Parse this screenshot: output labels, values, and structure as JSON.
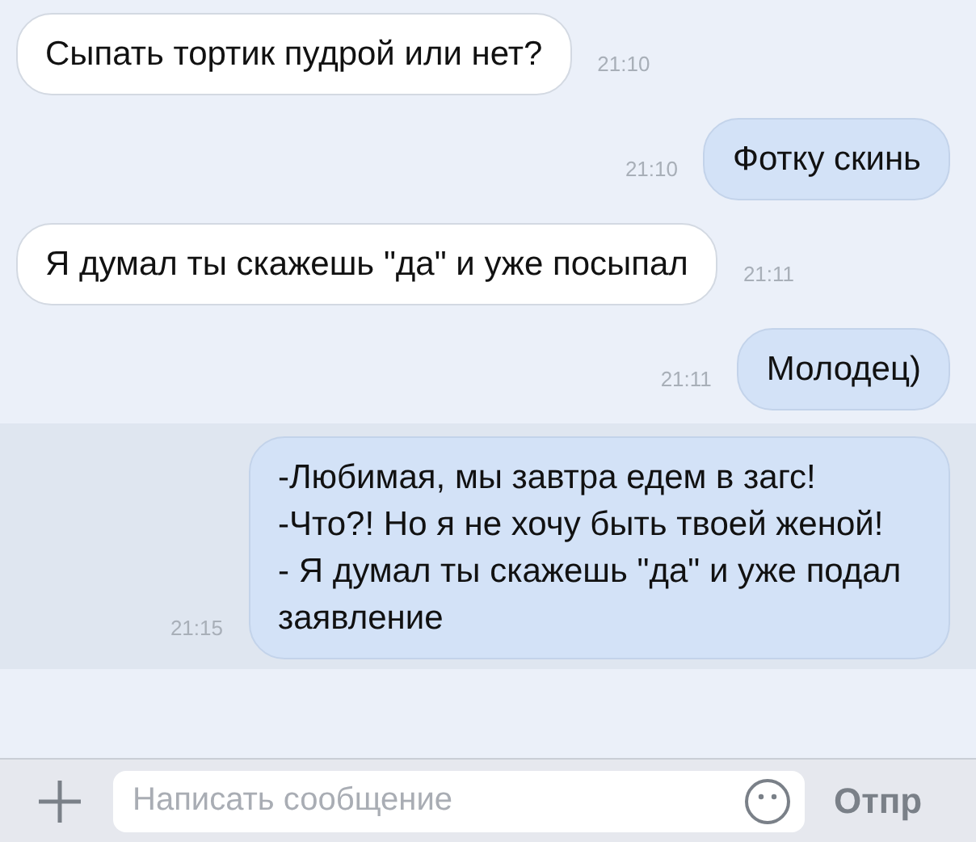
{
  "messages": [
    {
      "kind": "incoming",
      "text": "Сыпать тортик пудрой или нет?",
      "time": "21:10",
      "selected": false
    },
    {
      "kind": "outgoing",
      "text": "Фотку скинь",
      "time": "21:10",
      "selected": false
    },
    {
      "kind": "incoming",
      "text": "Я думал ты скажешь \"да\" и уже посыпал",
      "time": "21:11",
      "selected": false
    },
    {
      "kind": "outgoing",
      "text": "Молодец)",
      "time": "21:11",
      "selected": false
    },
    {
      "kind": "outgoing",
      "text": "-Любимая, мы завтра едем в загс!\n-Что?! Но я не хочу быть твоей женой!\n- Я думал ты скажешь \"да\" и уже подал заявление",
      "time": "21:15",
      "selected": true
    }
  ],
  "composer": {
    "placeholder": "Написать сообщение",
    "send_label": "Отпр"
  }
}
